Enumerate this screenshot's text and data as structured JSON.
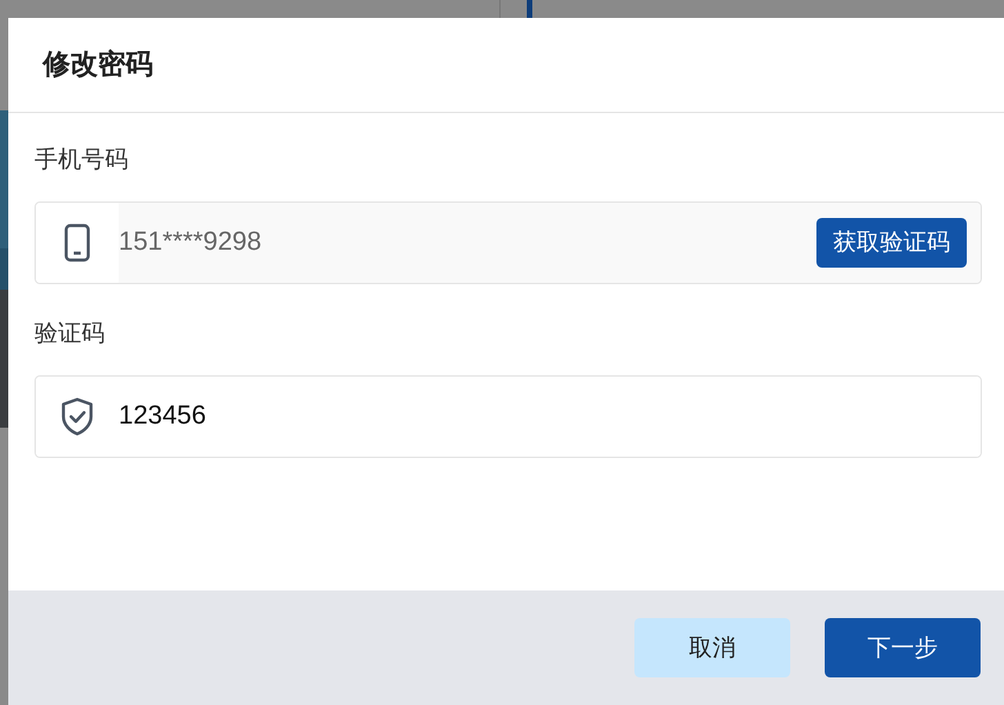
{
  "dialog": {
    "title": "修改密码",
    "fields": [
      {
        "kind": "phone",
        "label": "手机号码",
        "value": "151****9298",
        "disabled": true,
        "action": "获取验证码"
      },
      {
        "kind": "code",
        "label": "验证码",
        "value": "123456",
        "disabled": false
      }
    ],
    "buttons": [
      {
        "kind": "secondary",
        "label": "取消"
      },
      {
        "kind": "primary",
        "label": "下一步"
      }
    ]
  }
}
